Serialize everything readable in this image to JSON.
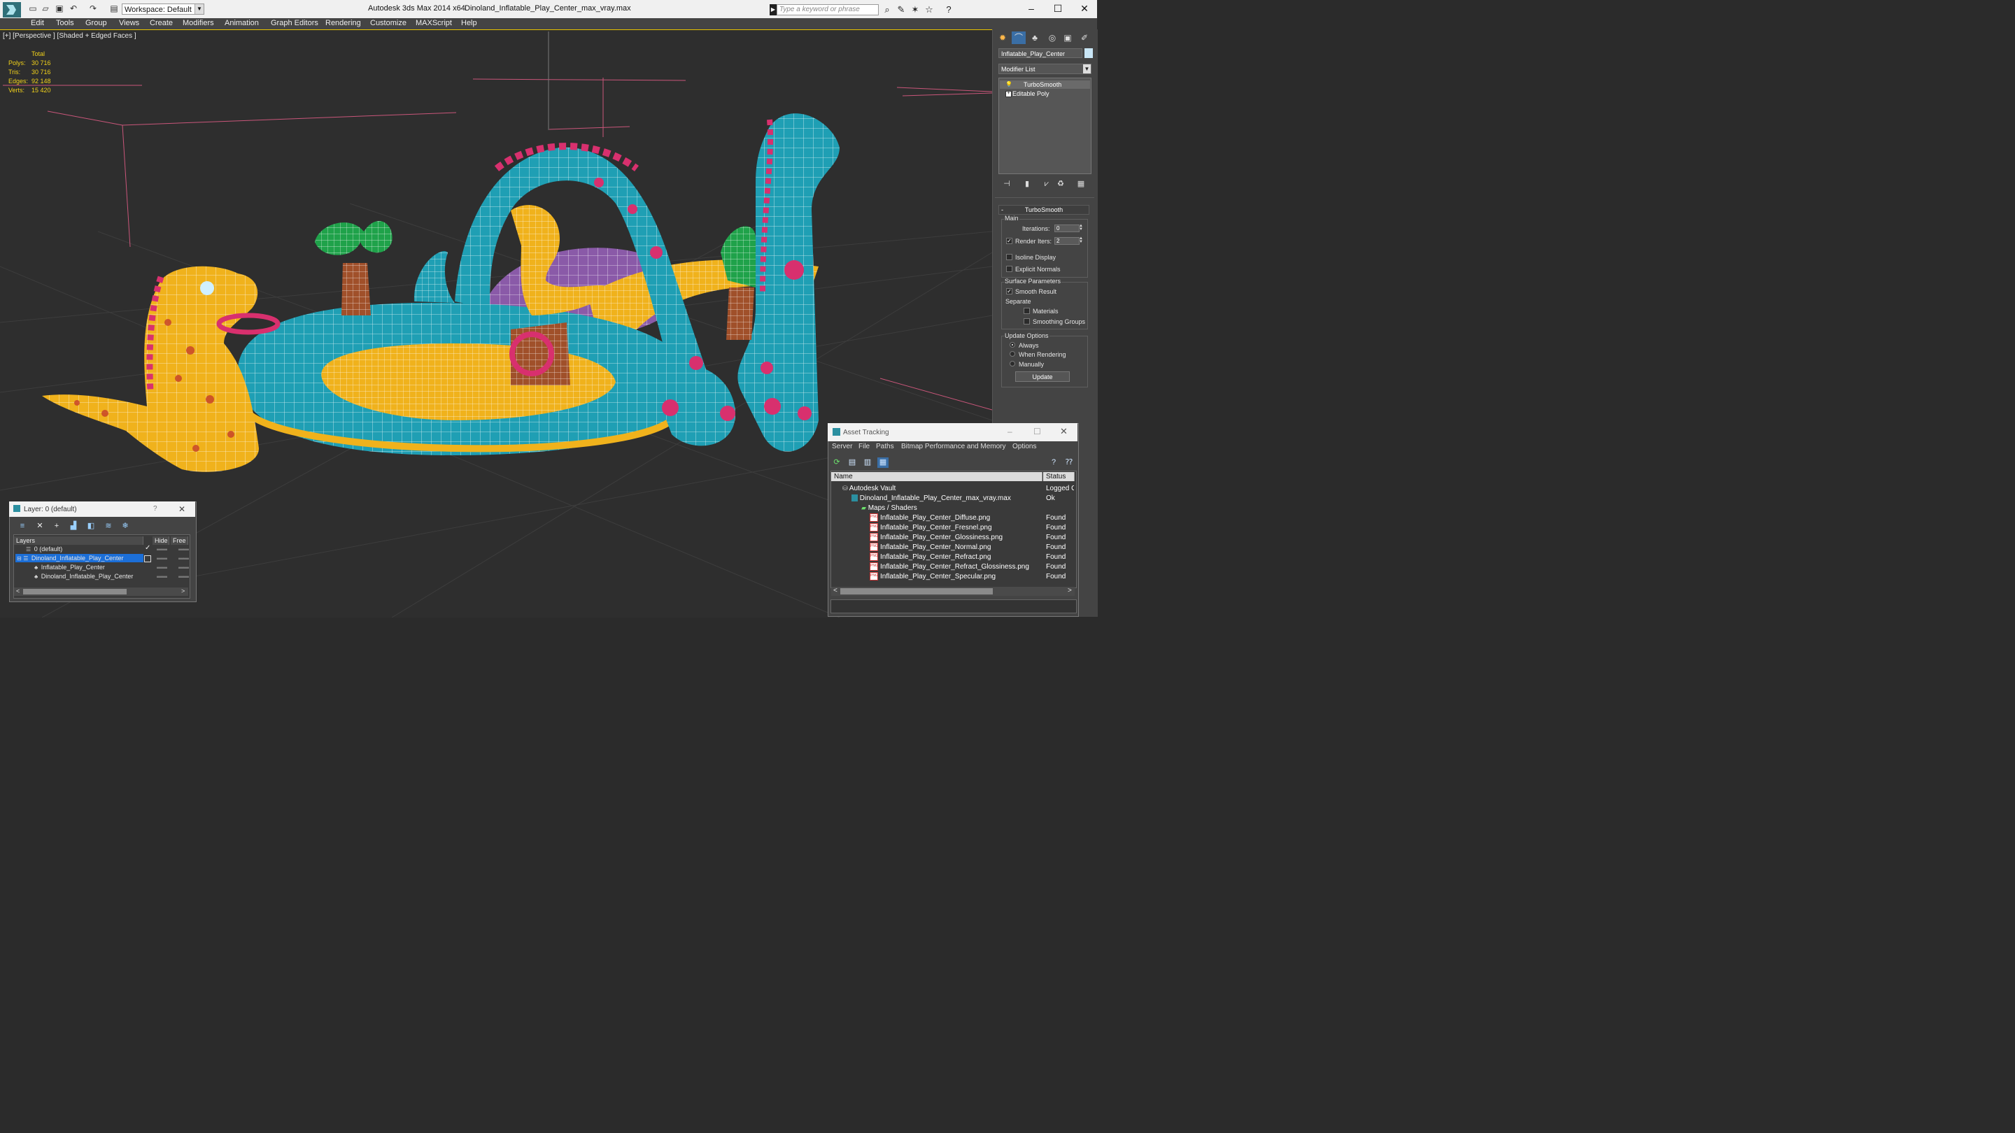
{
  "titlebar": {
    "workspace": "Workspace: Default",
    "app_title": "Autodesk 3ds Max 2014 x64",
    "file_title": "Dinoland_Inflatable_Play_Center_max_vray.max",
    "search_placeholder": "Type a keyword or phrase"
  },
  "menu": [
    "Edit",
    "Tools",
    "Group",
    "Views",
    "Create",
    "Modifiers",
    "Animation",
    "Graph Editors",
    "Rendering",
    "Customize",
    "MAXScript",
    "Help"
  ],
  "viewport": {
    "label": "[+] [Perspective ] [Shaded + Edged Faces ]",
    "stats_header": "Total",
    "stats": [
      {
        "label": "Polys:",
        "value": "30 716"
      },
      {
        "label": "Tris:",
        "value": "30 716"
      },
      {
        "label": "Edges:",
        "value": "92 148"
      },
      {
        "label": "Verts:",
        "value": "15 420"
      }
    ]
  },
  "command_panel": {
    "object_name": "Inflatable_Play_Center",
    "object_color": "#c9e6f6",
    "modifier_list": "Modifier List",
    "stack": [
      "TurboSmooth",
      "Editable Poly"
    ],
    "rollout_title": "TurboSmooth",
    "main_group": "Main",
    "iterations_label": "Iterations:",
    "iterations_value": "0",
    "render_iters_label": "Render Iters:",
    "render_iters_value": "2",
    "isoline_label": "Isoline Display",
    "explicit_normals_label": "Explicit Normals",
    "surface_group": "Surface Parameters",
    "smooth_result_label": "Smooth Result",
    "separate_label": "Separate",
    "materials_label": "Materials",
    "smoothing_groups_label": "Smoothing Groups",
    "update_group": "Update Options",
    "always_label": "Always",
    "when_rendering_label": "When Rendering",
    "manually_label": "Manually",
    "update_button": "Update"
  },
  "layer_dialog": {
    "title": "Layer: 0 (default)",
    "help": "?",
    "columns": [
      "Layers",
      "Hide",
      "Free"
    ],
    "rows": [
      {
        "name": "0 (default)",
        "indent": 1
      },
      {
        "name": "Dinoland_Inflatable_Play_Center",
        "indent": 1,
        "selected": true
      },
      {
        "name": "Inflatable_Play_Center",
        "indent": 2
      },
      {
        "name": "Dinoland_Inflatable_Play_Center",
        "indent": 2
      }
    ]
  },
  "asset_tracking": {
    "title": "Asset Tracking",
    "menu": [
      "Server",
      "File",
      "Paths",
      "Bitmap Performance and Memory",
      "Options"
    ],
    "columns": [
      "Name",
      "Status"
    ],
    "rows": [
      {
        "name": "Autodesk Vault",
        "status": "Logged O",
        "level": 0
      },
      {
        "name": "Dinoland_Inflatable_Play_Center_max_vray.max",
        "status": "Ok",
        "level": 1
      },
      {
        "name": "Maps / Shaders",
        "status": "",
        "level": 2
      },
      {
        "name": "Inflatable_Play_Center_Diffuse.png",
        "status": "Found",
        "level": 3
      },
      {
        "name": "Inflatable_Play_Center_Fresnel.png",
        "status": "Found",
        "level": 3
      },
      {
        "name": "Inflatable_Play_Center_Glossiness.png",
        "status": "Found",
        "level": 3
      },
      {
        "name": "Inflatable_Play_Center_Normal.png",
        "status": "Found",
        "level": 3
      },
      {
        "name": "Inflatable_Play_Center_Refract.png",
        "status": "Found",
        "level": 3
      },
      {
        "name": "Inflatable_Play_Center_Refract_Glossiness.png",
        "status": "Found",
        "level": 3
      },
      {
        "name": "Inflatable_Play_Center_Specular.png",
        "status": "Found",
        "level": 3
      }
    ]
  },
  "colors": {
    "teal": "#1f9fb4",
    "yellow": "#f0b21c",
    "purple": "#8a5aa8",
    "magenta": "#d8306e",
    "green": "#1fa24a",
    "brown": "#a0502a",
    "selection": "#1c6fd8",
    "viewport_border": "#e9c400"
  }
}
